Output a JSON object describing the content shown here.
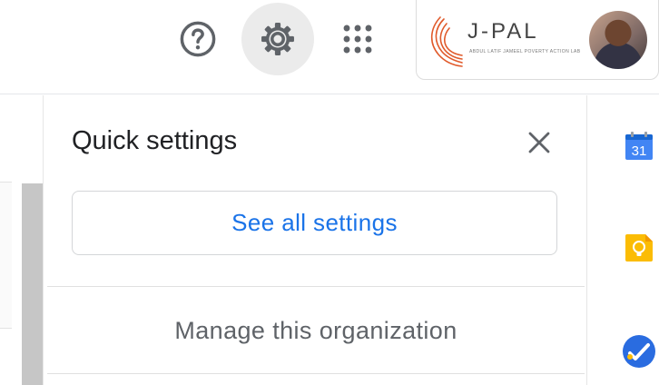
{
  "header": {
    "help_icon": "help-circle-icon",
    "settings_icon": "gear-icon",
    "apps_icon": "apps-grid-icon",
    "account": {
      "org_name": "J-PAL",
      "org_tagline": "ABDUL LATIF JAMEEL POVERTY ACTION LAB",
      "avatar": "user-avatar",
      "logo_color": "#e05a2b"
    }
  },
  "quick_settings": {
    "title": "Quick settings",
    "close_icon": "close-icon",
    "see_all_label": "See all settings",
    "manage_org_label": "Manage this organization"
  },
  "side_panel": {
    "calendar_day": "31",
    "apps": [
      "calendar-icon",
      "keep-icon",
      "tasks-icon"
    ]
  },
  "colors": {
    "accent": "#1a73e8",
    "gear_highlight": "#ebebeb",
    "calendar_blue": "#4285f4",
    "keep_yellow": "#fbbc04",
    "tasks_blue": "#2a6ce0"
  }
}
